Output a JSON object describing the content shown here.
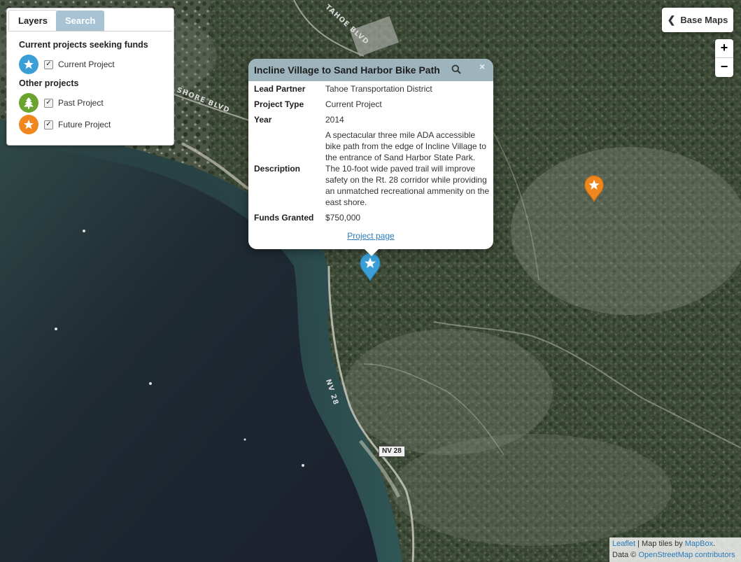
{
  "layers_panel": {
    "tabs": [
      {
        "label": "Layers",
        "active": true
      },
      {
        "label": "Search",
        "active": false
      }
    ],
    "section_current": "Current projects seeking funds",
    "section_other": "Other projects",
    "layers": [
      {
        "label": "Current Project",
        "icon": "star-icon",
        "color": "#3a9fd6",
        "checked": true
      },
      {
        "label": "Past Project",
        "icon": "tree-icon",
        "color": "#6aa32d",
        "checked": true
      },
      {
        "label": "Future Project",
        "icon": "star-icon",
        "color": "#f0861e",
        "checked": true
      }
    ]
  },
  "controls": {
    "base_maps_label": "Base Maps",
    "zoom_in": "+",
    "zoom_out": "−"
  },
  "popup": {
    "title": "Incline Village to Sand Harbor Bike Path",
    "rows": [
      {
        "label": "Lead Partner",
        "value": "Tahoe Transportation District"
      },
      {
        "label": "Project Type",
        "value": "Current Project"
      },
      {
        "label": "Year",
        "value": "2014"
      },
      {
        "label": "Description",
        "value": "A spectacular three mile ADA accessible bike path from the edge of Incline Village to the entrance of Sand Harbor State Park. The 10-foot wide paved trail will improve safety on the Rt. 28 corridor while providing an unmatched recreational ammenity on the east shore."
      },
      {
        "label": "Funds Granted",
        "value": "$750,000"
      }
    ],
    "link_label": "Project page",
    "close": "×"
  },
  "map": {
    "road_labels": [
      "TAHOE BLVD",
      "SHORE BLVD",
      "NV 28"
    ],
    "highway_shield": "NV 28",
    "markers": [
      {
        "type": "Current Project",
        "color": "#3a9fd6"
      },
      {
        "type": "Future Project",
        "color": "#f0861e"
      }
    ]
  },
  "attribution": {
    "leaflet": "Leaflet",
    "sep": " | Map tiles by ",
    "mapbox": "MapBox",
    "dot": ".",
    "data": "Data © ",
    "osm": "OpenStreetMap contributors"
  }
}
